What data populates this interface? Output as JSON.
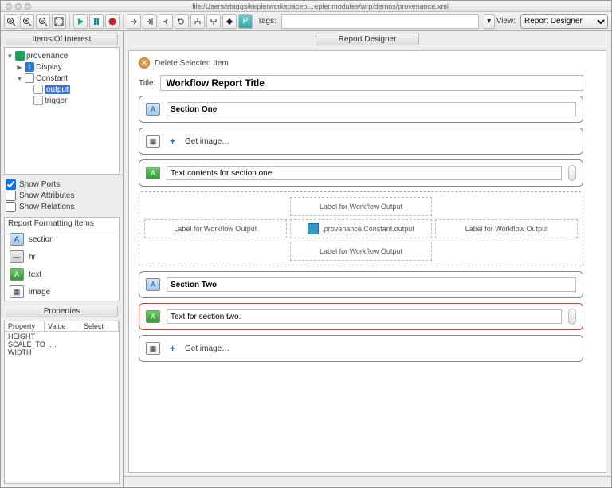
{
  "window": {
    "title_path": "file:/Users/staggs/keplerworkspacep…epler.modules/wrp/demos/provenance.xml"
  },
  "toolbar": {
    "tags_label": "Tags:",
    "tags_value": "",
    "view_label": "View:",
    "view_selected": "Report Designer"
  },
  "left": {
    "items_title": "Items Of Interest",
    "tree": {
      "root": "provenance",
      "display": "Display",
      "constant": "Constant",
      "output": "output",
      "trigger": "trigger"
    },
    "checks": {
      "show_ports": "Show Ports",
      "show_attributes": "Show Attributes",
      "show_relations": "Show Relations"
    },
    "rfi_title": "Report Formatting Items",
    "rfi": {
      "section": "section",
      "hr": "hr",
      "text": "text",
      "image": "image"
    },
    "props_title": "Properties",
    "props_cols": {
      "c1": "Property",
      "c2": "Value",
      "c3": "Select"
    },
    "props_rows": [
      "HEIGHT",
      "SCALE_TO_…",
      "WIDTH"
    ]
  },
  "designer": {
    "tab_title": "Report Designer",
    "delete_label": "Delete Selected Item",
    "title_label": "Title:",
    "title_value": "Workflow Report Title",
    "section_one": "Section One",
    "get_image": "Get image…",
    "text_one": "Text contents for section one.",
    "wf_label": "Label for Workflow Output",
    "center_item": ".provenance.Constant.output",
    "section_two": "Section Two",
    "text_two": "Text for section two."
  }
}
